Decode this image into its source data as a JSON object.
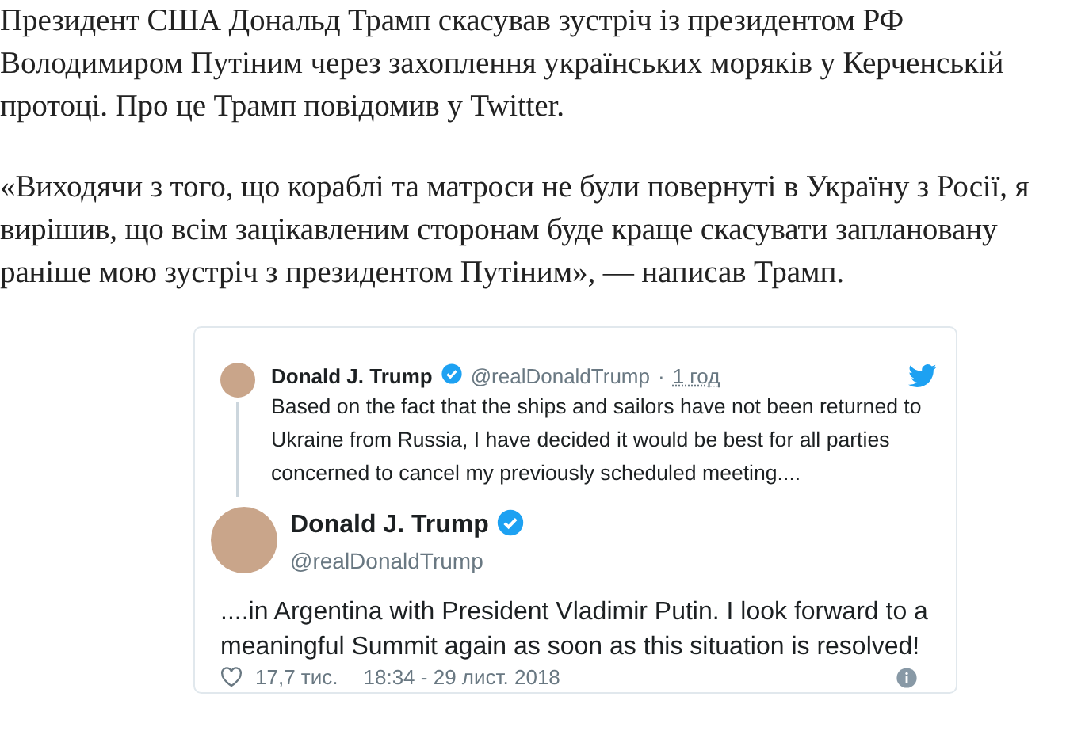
{
  "article": {
    "paragraphs": [
      "Президент США Дональд Трамп скасував зустріч із президентом РФ Володимиром Путіним через захоплення українських моряків у Керченській протоці. Про це Трамп повідомив у Twitter.",
      "«Виходячи з того, що кораблі та матроси не були повернуті в Україну з Росії, я вирішив, що всім зацікавленим сторонам буде краще скасувати заплановану раніше мою зустріч з президентом Путіним», — написав Трамп."
    ]
  },
  "embedded_tweet": {
    "parent": {
      "name": "Donald J. Trump",
      "verified": true,
      "handle": "@realDonaldTrump",
      "separator": "·",
      "time": "1 год",
      "text": "Based on the fact that the ships and sailors have not been returned to Ukraine from Russia, I have decided it would be best for all parties concerned to cancel my previously scheduled meeting...."
    },
    "main": {
      "name": "Donald J. Trump",
      "verified": true,
      "handle": "@realDonaldTrump",
      "text": "....in Argentina with President Vladimir Putin. I look forward to a meaningful Summit again as soon as this situation is resolved!",
      "likes": "17,7 тис.",
      "timestamp": "18:34 - 29 лист. 2018"
    }
  }
}
